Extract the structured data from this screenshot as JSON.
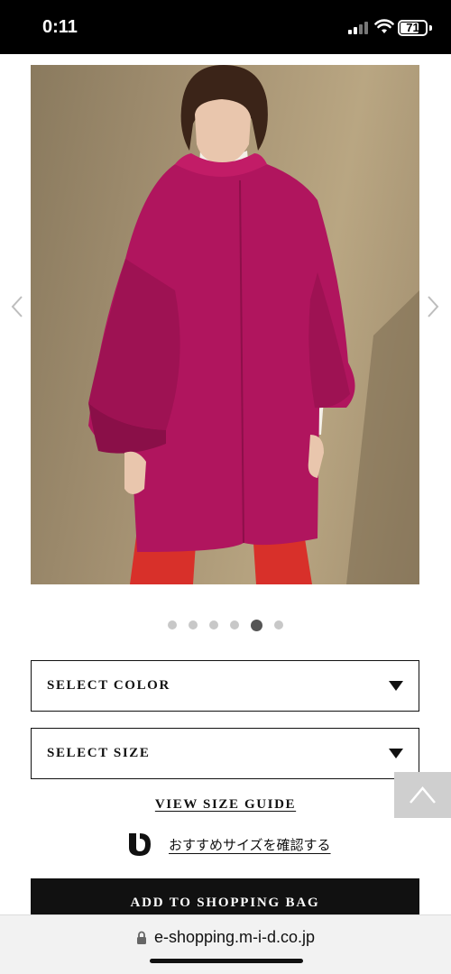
{
  "status_bar": {
    "time": "0:11",
    "battery": "71"
  },
  "product": {
    "image_alt": "Model wearing magenta wool coat with flared sleeves",
    "carousel": {
      "count": 6,
      "active_index": 4
    }
  },
  "options": {
    "color_label": "SELECT COLOR",
    "size_label": "SELECT SIZE"
  },
  "size_guide_label": "VIEW SIZE GUIDE",
  "recommend_label": "おすすめサイズを確認する",
  "add_to_bag_label": "ADD TO SHOPPING BAG",
  "browser": {
    "url": "e-shopping.m-i-d.co.jp"
  },
  "icons": {
    "prev": "chevron-left-icon",
    "next": "chevron-right-icon",
    "caret": "caret-down-icon",
    "scroll_top": "chevron-up-icon",
    "lock": "lock-icon",
    "recommend": "size-brand-icon"
  },
  "colors": {
    "coat": "#b0155e",
    "button": "#111111",
    "backdrop": "#a39071"
  }
}
